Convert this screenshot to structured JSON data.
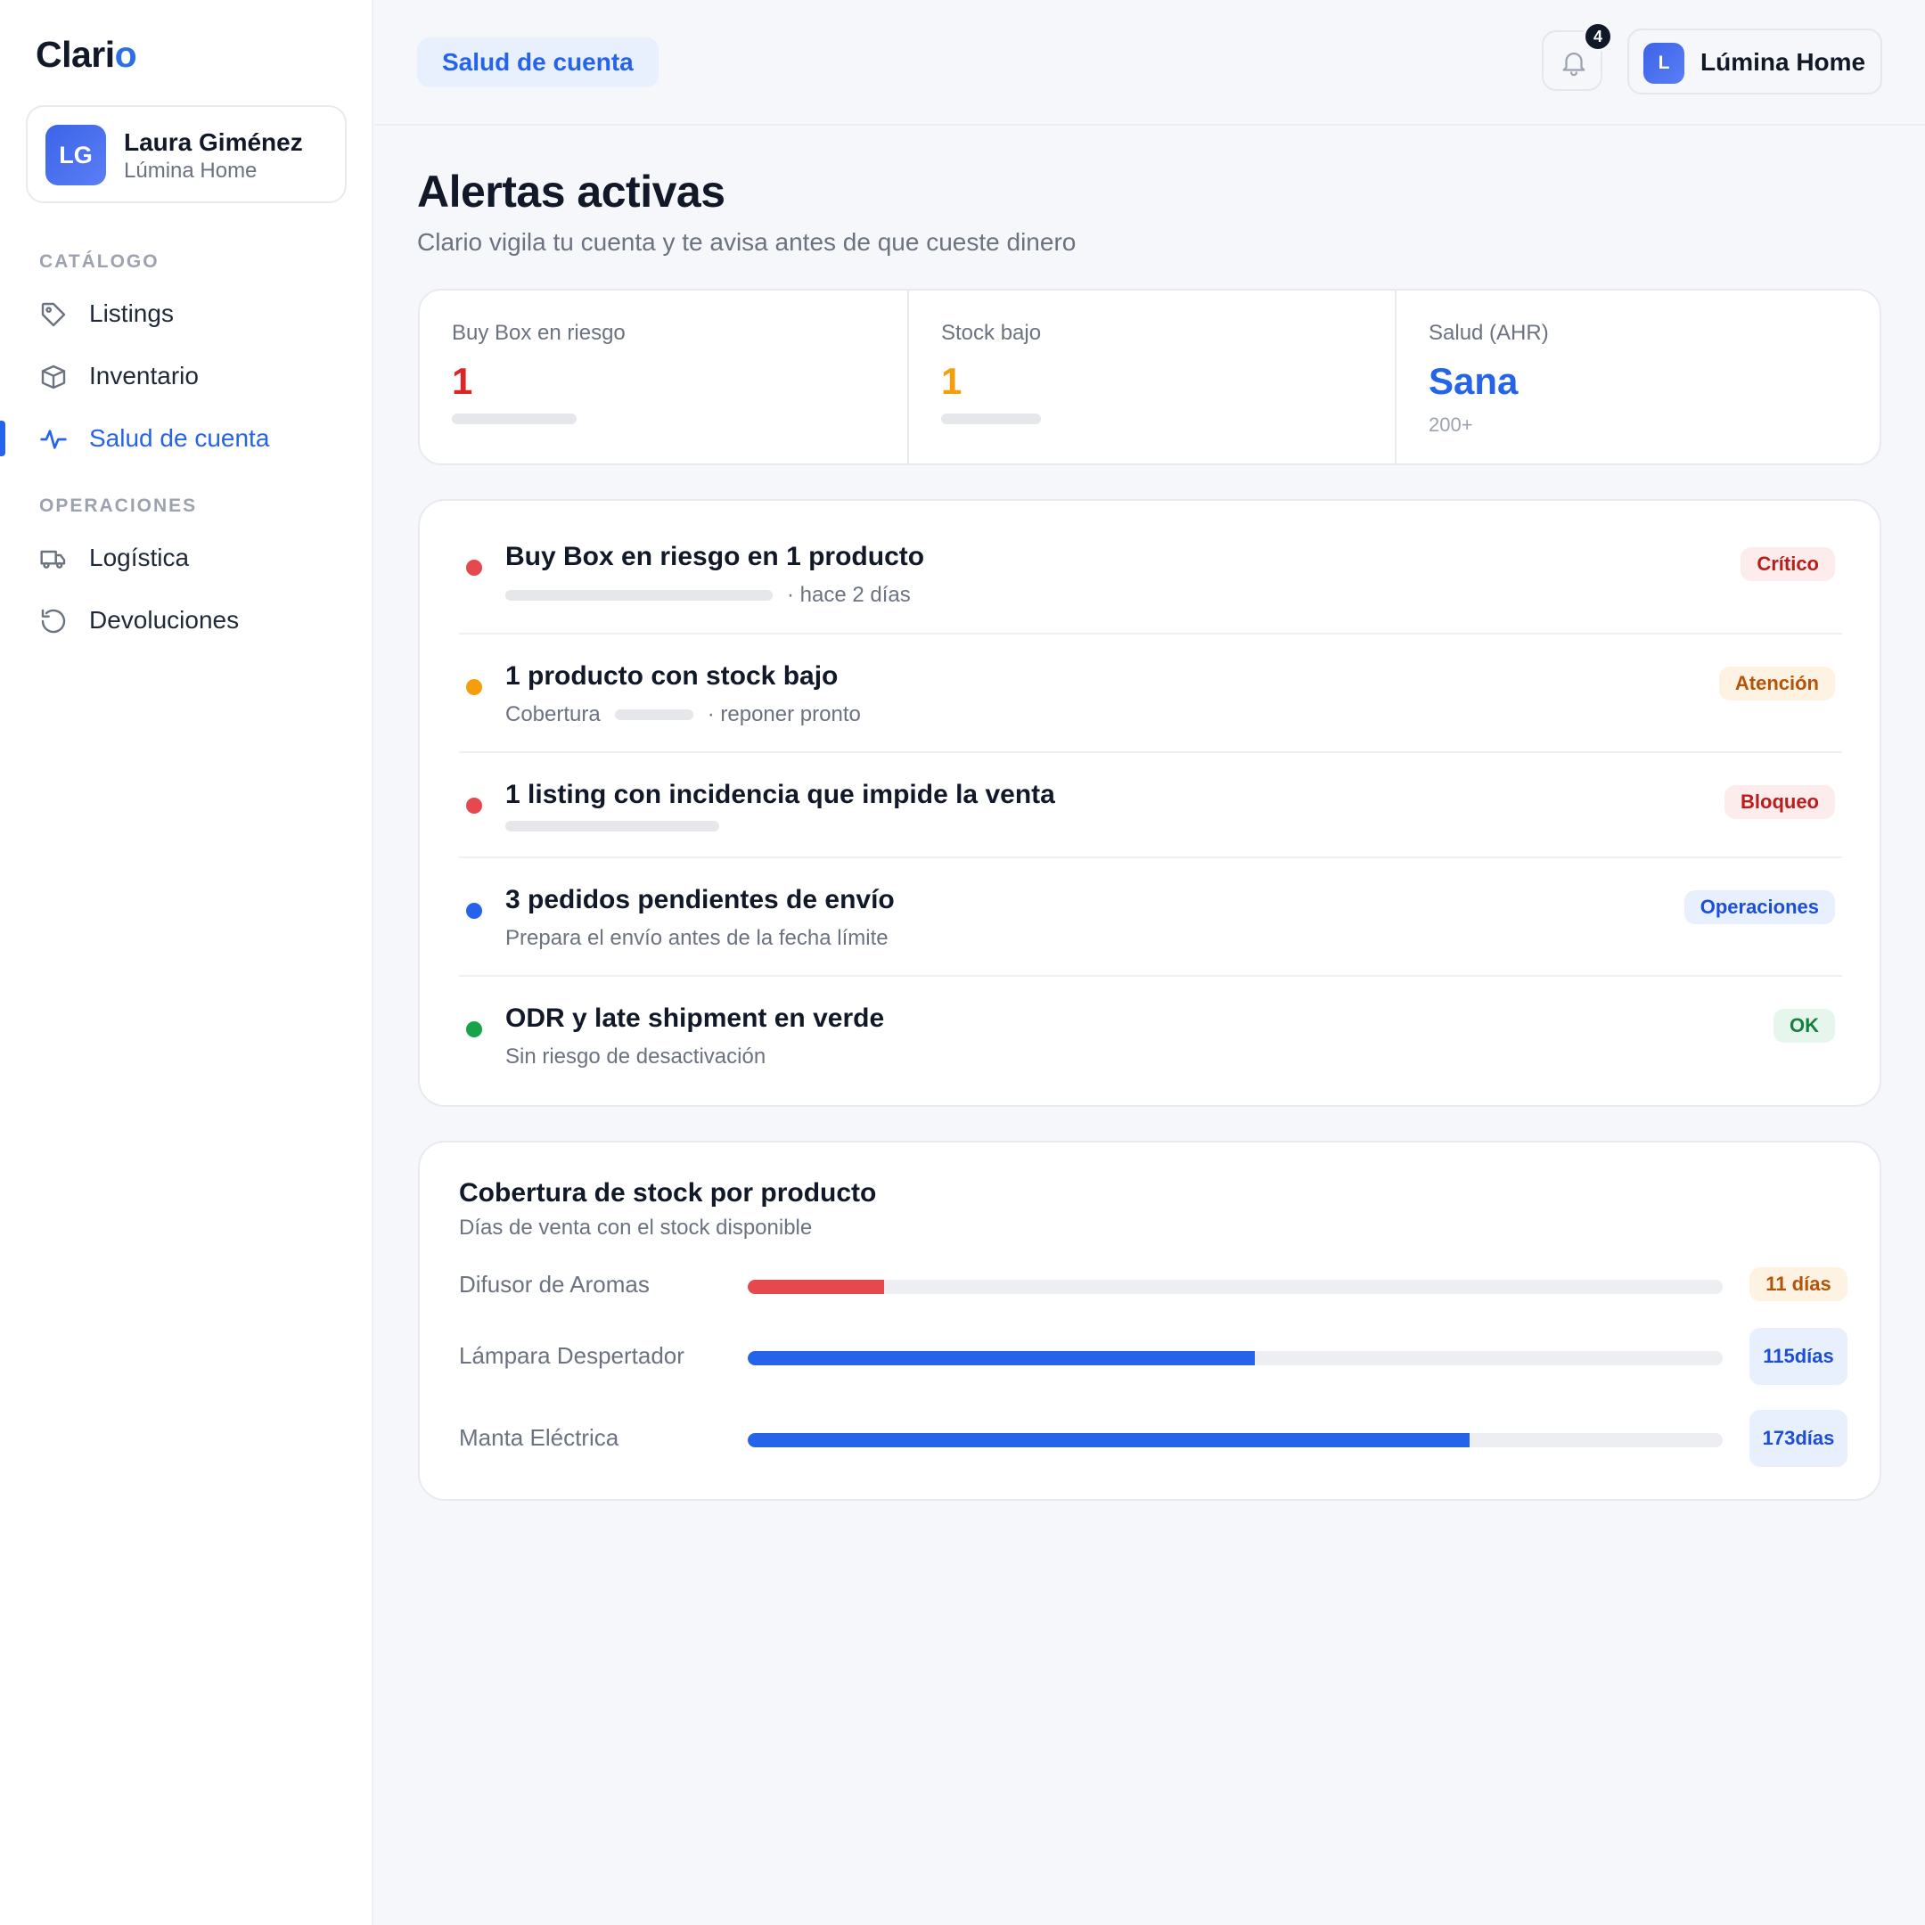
{
  "app": {
    "logo_main": "Clari",
    "logo_accent": "o"
  },
  "user": {
    "initials": "LG",
    "name": "Laura Giménez",
    "store": "Lúmina Home"
  },
  "sidebar": {
    "sections": [
      {
        "label": "CATÁLOGO",
        "items": [
          {
            "label": "Listings",
            "icon": "tag-icon"
          },
          {
            "label": "Inventario",
            "icon": "box-icon"
          },
          {
            "label": "Salud de cuenta",
            "icon": "activity-icon",
            "active": true
          }
        ]
      },
      {
        "label": "OPERACIONES",
        "items": [
          {
            "label": "Logística",
            "icon": "truck-icon"
          },
          {
            "label": "Devoluciones",
            "icon": "refresh-icon"
          }
        ]
      }
    ]
  },
  "header": {
    "breadcrumb": "Salud de cuenta",
    "notifications_count": "4",
    "store_initial": "L",
    "store_name": "Lúmina Home"
  },
  "page": {
    "title": "Alertas activas",
    "subtitle": "Clario vigila tu cuenta y te avisa antes de que cueste dinero"
  },
  "stats": [
    {
      "label": "Buy Box en riesgo",
      "value": "1",
      "color": "#dc2626"
    },
    {
      "label": "Stock bajo",
      "value": "1",
      "color": "#f59e0b"
    },
    {
      "label": "Salud (AHR)",
      "value": "Sana",
      "color": "#2563eb",
      "footnote": "200+"
    }
  ],
  "alerts": [
    {
      "title": "Buy Box en riesgo en 1 producto",
      "meta_suffix": "· hace 2 días",
      "badge": "Crítico",
      "dot": "#e5484d",
      "badge_bg": "#fdecec",
      "badge_fg": "#b91c1c"
    },
    {
      "title": "1 producto con stock bajo",
      "meta_prefix": "Cobertura",
      "meta_suffix": "· reponer pronto",
      "badge": "Atención",
      "dot": "#f59e0b",
      "badge_bg": "#fef3e2",
      "badge_fg": "#b45309"
    },
    {
      "title": "1 listing con incidencia que impide la venta",
      "badge": "Bloqueo",
      "dot": "#e5484d",
      "badge_bg": "#fdecec",
      "badge_fg": "#b91c1c"
    },
    {
      "title": "3 pedidos pendientes de envío",
      "meta": "Prepara el envío antes de la fecha límite",
      "badge": "Operaciones",
      "dot": "#2563eb",
      "badge_bg": "#e8f0fd",
      "badge_fg": "#1d4ed8"
    },
    {
      "title": "ODR y late shipment en verde",
      "meta": "Sin riesgo de desactivación",
      "badge": "OK",
      "dot": "#16a34a",
      "badge_bg": "#e7f6ec",
      "badge_fg": "#15803d"
    }
  ],
  "coverage": {
    "title": "Cobertura de stock por producto",
    "subtitle": "Días de venta con el stock disponible",
    "rows": [
      {
        "product": "Difusor de Aromas",
        "days_label": "11 días",
        "fraction": 0.14,
        "bar": "#e5484d",
        "badge_bg": "#fef3e2",
        "badge_fg": "#b45309"
      },
      {
        "product": "Lámpara Despertador",
        "days_label": "115 días",
        "fraction": 0.52,
        "bar": "#2563eb",
        "badge_bg": "#e8f0fd",
        "badge_fg": "#1d4ed8"
      },
      {
        "product": "Manta Eléctrica",
        "days_label": "173 días",
        "fraction": 0.74,
        "bar": "#2563eb",
        "badge_bg": "#e8f0fd",
        "badge_fg": "#1d4ed8"
      }
    ]
  }
}
